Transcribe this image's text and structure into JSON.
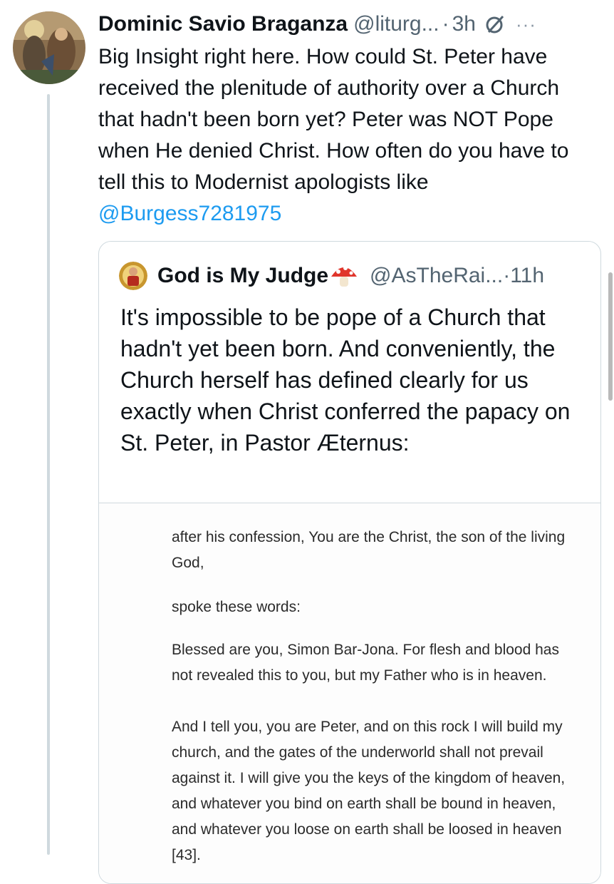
{
  "tweet": {
    "display_name": "Dominic Savio Braganza",
    "handle": "@liturg...",
    "separator": "·",
    "time": "3h",
    "more": "···",
    "text": "Big Insight right here. How could St. Peter have received the plenitude of authority over a Church that hadn't been born yet? Peter was NOT Pope when He denied Christ. How often do you have to tell this to Modernist apologists like ",
    "mention": "@Burgess7281975",
    "icons": {
      "avatar": "saints-painting-avatar",
      "grok": "grok-slash-icon",
      "more": "more-icon"
    }
  },
  "quote": {
    "display_name": "God is My Judge",
    "emoji": "mushroom-icon",
    "handle": "@AsTheRai...",
    "separator": "·",
    "time": "11h",
    "text": "It's impossible to be pope of a Church that hadn't yet been born. And conveniently, the Church herself has defined clearly for us exactly when Christ conferred the papacy on St. Peter, in Pastor Æternus:",
    "image_text": {
      "p1": "after his confession, You are the Christ, the son of the living God,",
      "p2": "spoke these words:",
      "p3": "Blessed are you, Simon Bar-Jona. For flesh and blood has not revealed this to you, but my Father who is in heaven.",
      "p4": "And I tell you, you are Peter, and on this rock I will build my church, and the gates of the underworld shall not prevail against it. I will give you the keys of the kingdom of heaven, and whatever you bind on earth shall be bound in heaven, and whatever you loose on earth shall be loosed in heaven [43]."
    }
  },
  "colors": {
    "link": "#1d9bf0",
    "secondary_text": "#536471",
    "border": "#cfd9de"
  }
}
